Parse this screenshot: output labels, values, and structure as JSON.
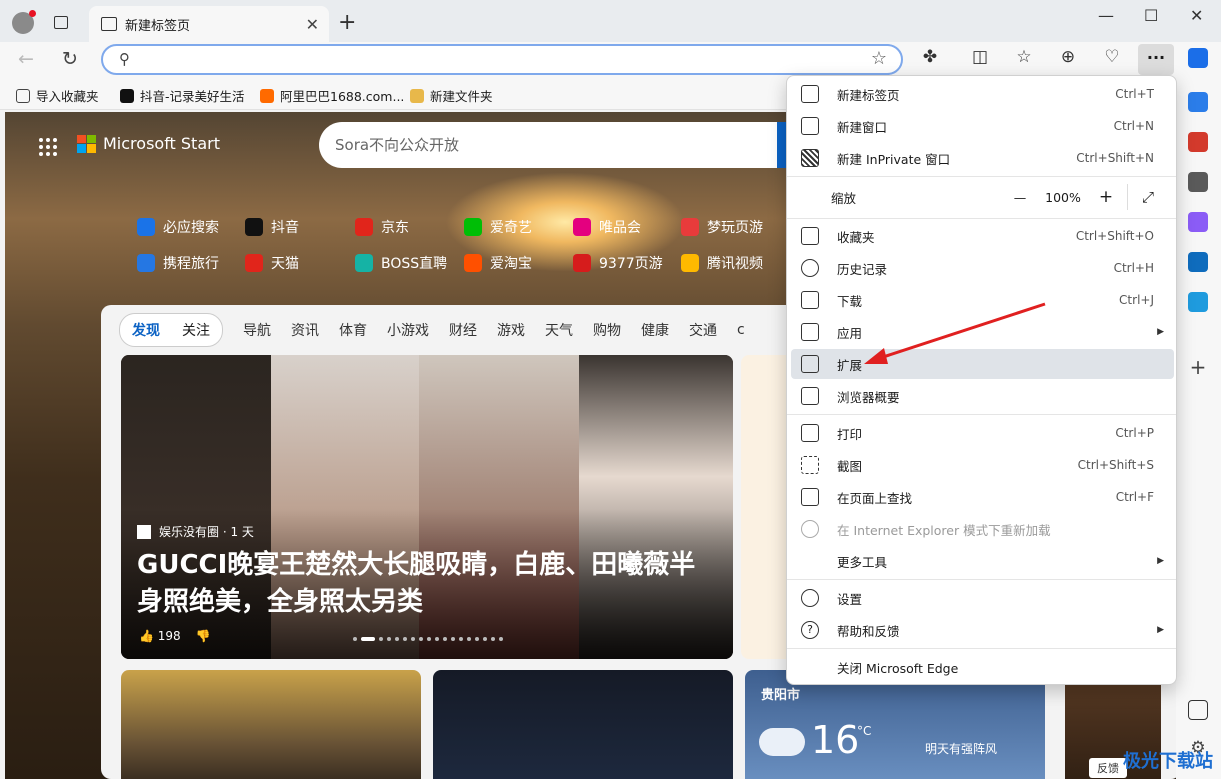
{
  "tab": {
    "title": "新建标签页"
  },
  "address": {
    "placeholder": ""
  },
  "bookmarks": [
    {
      "label": "导入收藏夹",
      "color": "#444444"
    },
    {
      "label": "抖音-记录美好生活",
      "color": "#111111"
    },
    {
      "label": "阿里巴巴1688.com...",
      "color": "#ff6a00"
    },
    {
      "label": "新建文件夹",
      "color": "#e8b84a"
    }
  ],
  "brand": {
    "name": "Microsoft Start"
  },
  "search": {
    "placeholder": "Sora不向公众开放"
  },
  "quicklinks": [
    {
      "label": "必应搜索",
      "color": "#1a73e8"
    },
    {
      "label": "抖音",
      "color": "#111111"
    },
    {
      "label": "京东",
      "color": "#e1251b"
    },
    {
      "label": "爱奇艺",
      "color": "#00be06"
    },
    {
      "label": "唯品会",
      "color": "#e4007f"
    },
    {
      "label": "梦玩页游",
      "color": "#e83b3b"
    },
    {
      "label": "携程旅行",
      "color": "#2577e3"
    },
    {
      "label": "天猫",
      "color": "#e1251b"
    },
    {
      "label": "BOSS直聘",
      "color": "#15b3a5"
    },
    {
      "label": "爱淘宝",
      "color": "#ff5000"
    },
    {
      "label": "9377页游",
      "color": "#d61c1c"
    },
    {
      "label": "腾讯视频",
      "color": "#ffb900"
    }
  ],
  "feed": {
    "pill": [
      "发现",
      "关注"
    ],
    "categories": [
      "导航",
      "资讯",
      "体育",
      "小游戏",
      "财经",
      "游戏",
      "天气",
      "购物",
      "健康",
      "交通",
      "c"
    ]
  },
  "hero": {
    "source": "娱乐没有圈 · 1 天",
    "title": "GUCCI晚宴王楚然大长腿吸睛，白鹿、田曦薇半身照绝美，全身照太另类",
    "likes": "198"
  },
  "weather": {
    "city": "贵阳市",
    "temp": "16",
    "unit": "°C",
    "forecast": "明天有强阵风"
  },
  "feedback": "反馈",
  "menu": {
    "items": [
      {
        "label": "新建标签页",
        "shortcut": "Ctrl+T",
        "icon": "new-tab-icon"
      },
      {
        "label": "新建窗口",
        "shortcut": "Ctrl+N",
        "icon": "new-window-icon"
      },
      {
        "label": "新建 InPrivate 窗口",
        "shortcut": "Ctrl+Shift+N",
        "icon": "inprivate-icon"
      },
      {
        "label": "收藏夹",
        "shortcut": "Ctrl+Shift+O",
        "icon": "favorites-icon"
      },
      {
        "label": "历史记录",
        "shortcut": "Ctrl+H",
        "icon": "history-icon"
      },
      {
        "label": "下载",
        "shortcut": "Ctrl+J",
        "icon": "download-icon"
      },
      {
        "label": "应用",
        "shortcut": "",
        "icon": "apps-icon"
      },
      {
        "label": "扩展",
        "shortcut": "",
        "icon": "extensions-icon"
      },
      {
        "label": "浏览器概要",
        "shortcut": "",
        "icon": "browser-essentials-icon"
      },
      {
        "label": "打印",
        "shortcut": "Ctrl+P",
        "icon": "print-icon"
      },
      {
        "label": "截图",
        "shortcut": "Ctrl+Shift+S",
        "icon": "screenshot-icon"
      },
      {
        "label": "在页面上查找",
        "shortcut": "Ctrl+F",
        "icon": "find-icon"
      },
      {
        "label": "在 Internet Explorer 模式下重新加载",
        "shortcut": "",
        "icon": "ie-mode-icon"
      },
      {
        "label": "更多工具",
        "shortcut": "",
        "icon": "more-tools-icon"
      },
      {
        "label": "设置",
        "shortcut": "",
        "icon": "settings-icon"
      },
      {
        "label": "帮助和反馈",
        "shortcut": "",
        "icon": "help-icon"
      },
      {
        "label": "关闭 Microsoft Edge",
        "shortcut": "",
        "icon": "close-edge-icon"
      }
    ],
    "zoom": {
      "label": "缩放",
      "value": "100%",
      "minus": "—",
      "plus": "+"
    }
  },
  "watermark": "极光下载站"
}
